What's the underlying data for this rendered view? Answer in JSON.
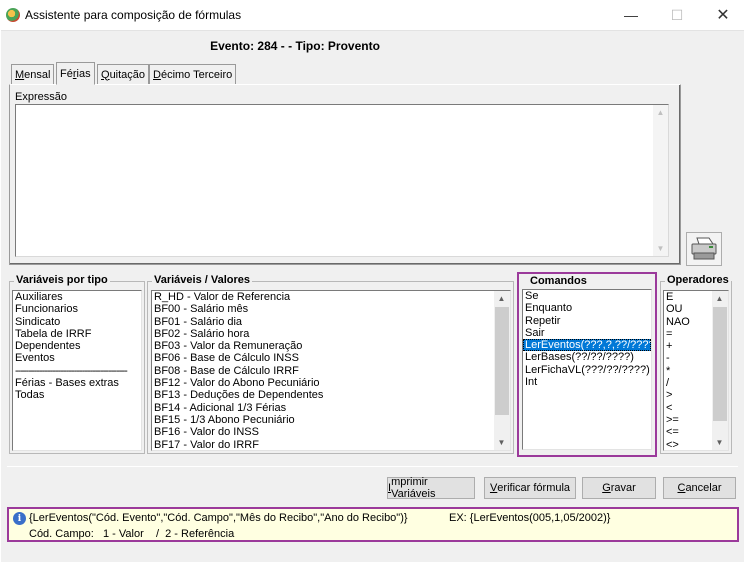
{
  "window": {
    "title": "Assistente para composição de fórmulas",
    "minimize": "—",
    "maximize": "☐",
    "close": "✕"
  },
  "event": {
    "label": "Evento:",
    "number": "284 -",
    "tipo_label": "- Tipo:",
    "tipo": "Provento"
  },
  "tabs": [
    {
      "label": "Mensal",
      "accel": "M",
      "rest": "ensal",
      "active": false
    },
    {
      "label": "Férias",
      "accel": "r",
      "pre": "Fé",
      "rest": "ias",
      "active": true
    },
    {
      "label": "Quitação",
      "accel": "Q",
      "rest": "uitação",
      "active": false
    },
    {
      "label": "Décimo Terceiro",
      "accel": "D",
      "rest": "écimo Terceiro",
      "active": false
    }
  ],
  "expression": {
    "label": "Expressão",
    "value": ""
  },
  "groups": {
    "tipo": {
      "title": "Variáveis por tipo",
      "items": [
        "Auxiliares",
        "Funcionarios",
        "Sindicato",
        "Tabela de IRRF",
        "Dependentes",
        "Eventos",
        "------------------------------------------",
        "Férias - Bases extras",
        "Todas"
      ]
    },
    "vars": {
      "title": "Variáveis / Valores",
      "items": [
        "R_HD - Valor de Referencia",
        "BF00 - Salário mês",
        "BF01 - Salário dia",
        "BF02 - Salário hora",
        "BF03 - Valor da Remuneração",
        "BF06 - Base de Cálculo INSS",
        "BF08 - Base de Cálculo IRRF",
        "BF12 - Valor do Abono Pecuniário",
        "BF13 - Deduções de Dependentes",
        "BF14 - Adicional 1/3 Férias",
        "BF15 - 1/3 Abono Pecuniário",
        "BF16 - Valor do INSS",
        "BF17 - Valor do IRRF"
      ]
    },
    "cmd": {
      "title": "Comandos",
      "items": [
        "Se",
        "Enquanto",
        "Repetir",
        "Sair",
        "LerEventos(???,?,??/????)",
        "LerBases(??/??/????)",
        "LerFichaVL(???/??/????)",
        "Int"
      ],
      "selected_index": 4
    },
    "ops": {
      "title": "Operadores",
      "items": [
        "E",
        "OU",
        "NAO",
        "=",
        "+",
        "-",
        "*",
        "/",
        ">",
        "<",
        ">=",
        "<=",
        "<>"
      ]
    }
  },
  "buttons": {
    "imprimir": {
      "accel": "I",
      "rest": "mprimir Variáveis"
    },
    "verificar": {
      "accel": "V",
      "rest": "erificar fórmula"
    },
    "gravar": {
      "accel": "G",
      "rest": "ravar"
    },
    "cancelar": {
      "accel": "C",
      "rest": "ancelar"
    }
  },
  "hint": {
    "syntax": "{LerEventos(\"Cód. Evento\",\"Cód. Campo\",\"Mês do Recibo\",\"Ano do Recibo\")}",
    "example": "EX: {LerEventos(005,1,05/2002)}",
    "campo": "Cód. Campo:   1 - Valor    /  2 - Referência"
  },
  "colors": {
    "highlight_border": "#9b3a9b",
    "selection": "#0078d7",
    "hint_background": "#ffffe1"
  },
  "icons": [
    "app-icon",
    "printer-icon",
    "info-icon"
  ]
}
